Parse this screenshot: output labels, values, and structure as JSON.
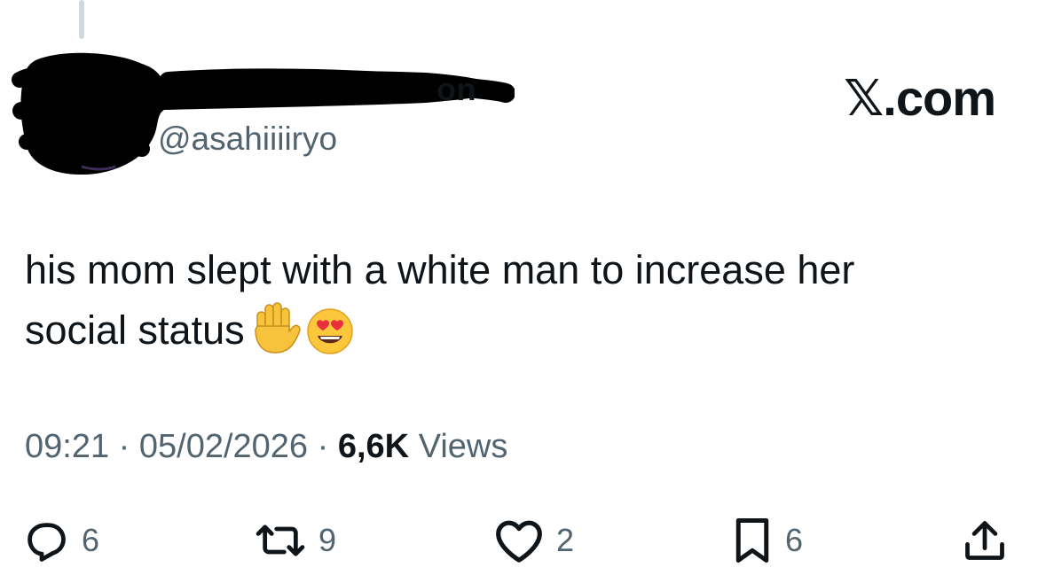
{
  "author": {
    "name_visible": "on",
    "handle": "@asahiiiiryo"
  },
  "brand": {
    "label": ".com",
    "icon": "x-logo-icon"
  },
  "tweet": {
    "text_line1": "his mom slept with a white man to increase her",
    "text_line2": "social status",
    "emojis": [
      "raised-hand-emoji",
      "heart-eyes-emoji"
    ]
  },
  "meta": {
    "time": "09:21",
    "separator": "·",
    "date": "05/02/2026",
    "views_count": "6,6K",
    "views_label": "Views"
  },
  "actions": {
    "replies": "6",
    "reposts": "9",
    "likes": "2",
    "bookmarks": "6"
  },
  "colors": {
    "text": "#0f1419",
    "secondary": "#536471",
    "thread_line": "#cfd9de",
    "redaction": "#000000"
  }
}
